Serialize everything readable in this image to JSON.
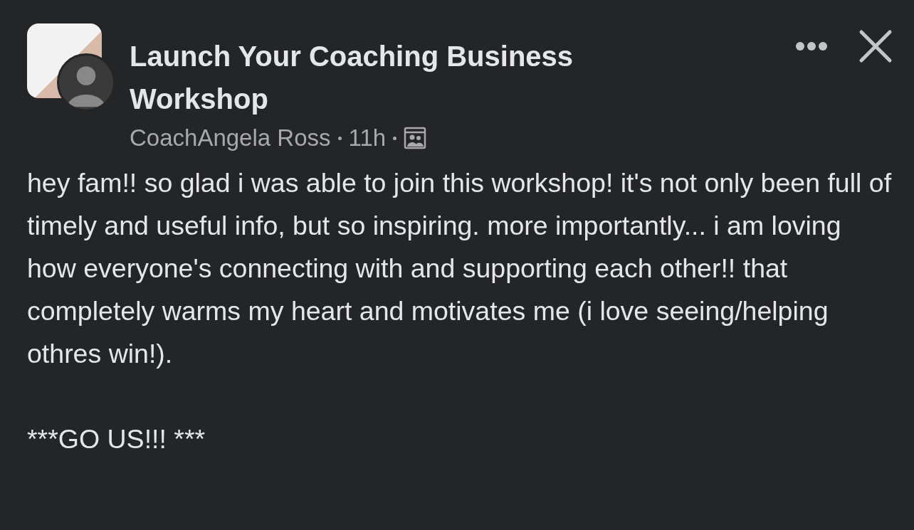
{
  "post": {
    "group_name": "Launch Your Coaching Business Workshop",
    "author": "CoachAngela Ross",
    "time": "11h",
    "paragraphs": [
      "hey fam!! so glad i was able to join this workshop! it's not only been full of timely and useful info, but so inspiring. more importantly... i am loving how everyone's connecting with and supporting each other!! that completely warms my heart and motivates me (i love seeing/helping othres win!).",
      "***GO US!!! ***"
    ]
  }
}
